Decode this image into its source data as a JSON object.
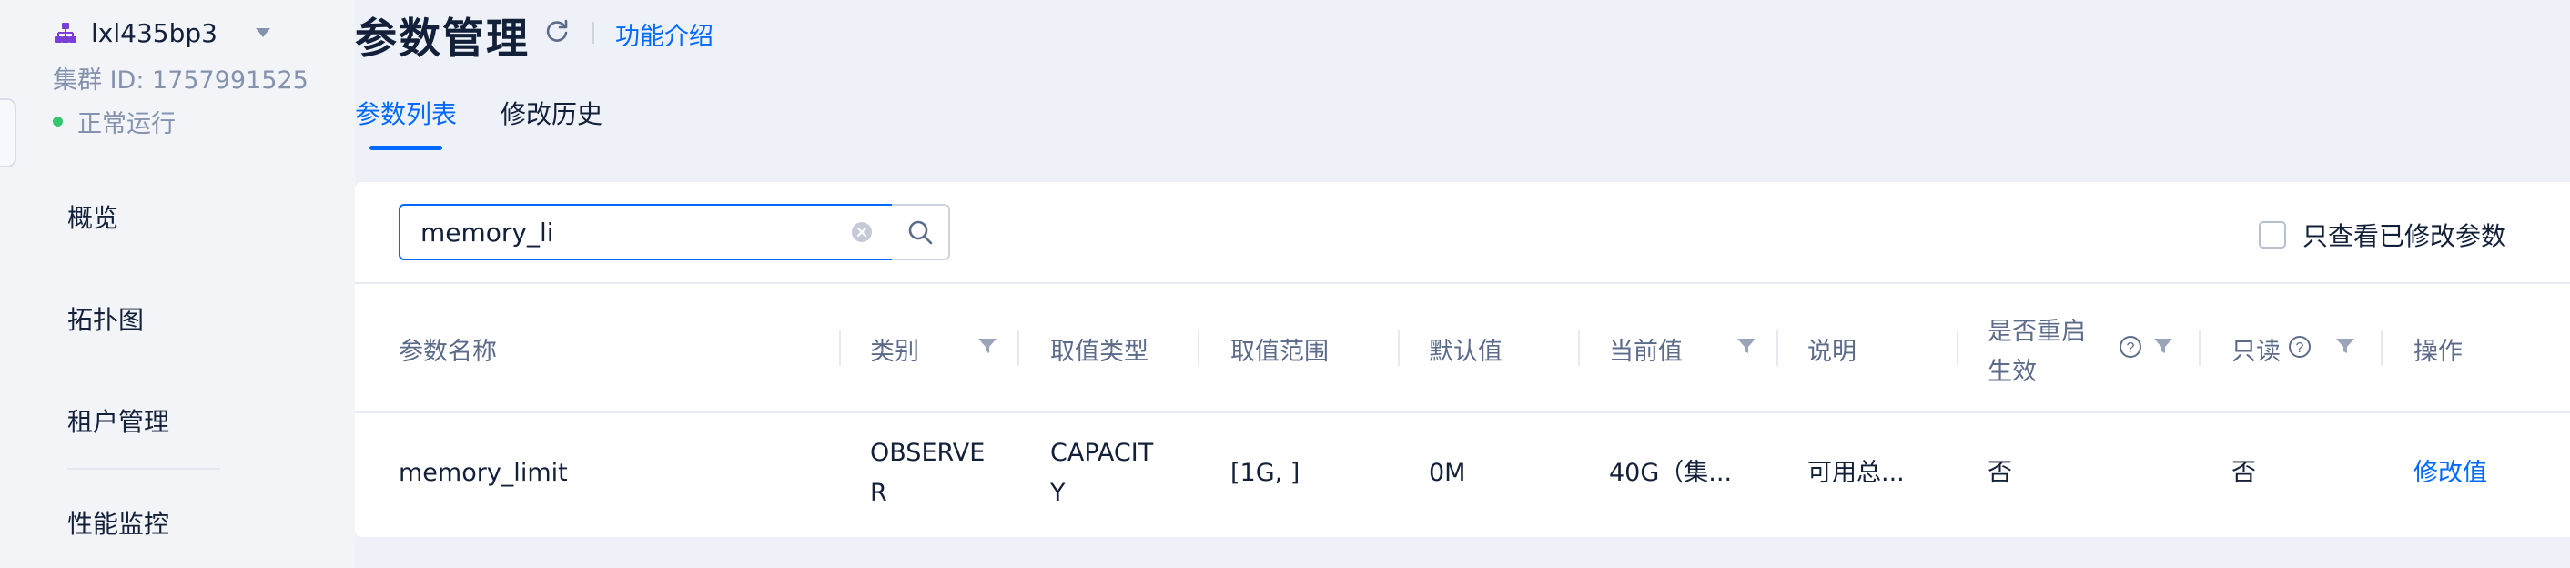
{
  "sidebar": {
    "cluster_name": "lxl435bp3",
    "cluster_id": "集群 ID: 1757991525",
    "status": "正常运行",
    "status_color": "#36c46f",
    "nav": [
      {
        "label": "概览"
      },
      {
        "label": "拓扑图"
      },
      {
        "label": "租户管理"
      },
      {
        "label": "性能监控"
      }
    ]
  },
  "header": {
    "title": "参数管理",
    "intro_link": "功能介绍",
    "tabs": [
      {
        "label": "参数列表",
        "active": true
      },
      {
        "label": "修改历史",
        "active": false
      }
    ]
  },
  "search": {
    "value": "memory_li"
  },
  "filters": {
    "only_modified_label": "只查看已修改参数",
    "only_modified_checked": false
  },
  "table": {
    "columns": {
      "name": "参数名称",
      "category": "类别",
      "value_type": "取值类型",
      "range": "取值范围",
      "default": "默认值",
      "current": "当前值",
      "desc": "说明",
      "restart_line1": "是否重启",
      "restart_line2": "生效",
      "readonly": "只读",
      "action": "操作"
    },
    "rows": [
      {
        "name": "memory_limit",
        "category_line1": "OBSERVE",
        "category_line2": "R",
        "value_type_line1": "CAPACIT",
        "value_type_line2": "Y",
        "range": "[1G, ]",
        "default": "0M",
        "current": "40G（集...",
        "desc": "可用总...",
        "restart": "否",
        "readonly": "否",
        "action": "修改值"
      }
    ]
  },
  "colors": {
    "accent": "#006aff",
    "background": "#eef1f7"
  }
}
